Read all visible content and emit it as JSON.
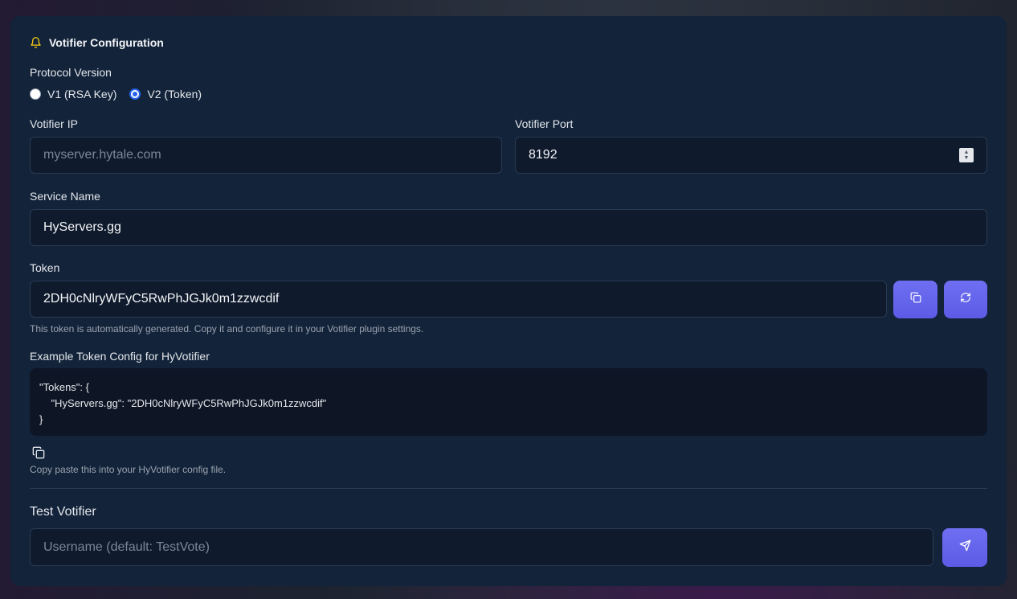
{
  "header": {
    "title": "Votifier Configuration",
    "icon": "bell-icon",
    "icon_color": "#facc15"
  },
  "protocol": {
    "label": "Protocol Version",
    "options": [
      {
        "label": "V1 (RSA Key)",
        "selected": false
      },
      {
        "label": "V2 (Token)",
        "selected": true
      }
    ]
  },
  "votifier_ip": {
    "label": "Votifier IP",
    "value": "",
    "placeholder": "myserver.hytale.com"
  },
  "votifier_port": {
    "label": "Votifier Port",
    "value": "8192"
  },
  "service_name": {
    "label": "Service Name",
    "value": "HyServers.gg"
  },
  "token": {
    "label": "Token",
    "value": "2DH0cNlryWFyC5RwPhJGJk0m1zzwcdif",
    "help": "This token is automatically generated. Copy it and configure it in your Votifier plugin settings.",
    "copy_icon": "copy-icon",
    "regenerate_icon": "refresh-icon"
  },
  "example": {
    "label": "Example Token Config for HyVotifier",
    "code": "\"Tokens\": {\n    \"HyServers.gg\": \"2DH0cNlryWFyC5RwPhJGJk0m1zzwcdif\"\n}",
    "copy_icon": "copy-icon",
    "help": "Copy paste this into your HyVotifier config file."
  },
  "test": {
    "title": "Test Votifier",
    "placeholder": "Username (default: TestVote)",
    "send_icon": "send-icon"
  },
  "colors": {
    "accent": "#6366f1",
    "card": "#12233a",
    "input_bg": "#0f1b2d"
  }
}
